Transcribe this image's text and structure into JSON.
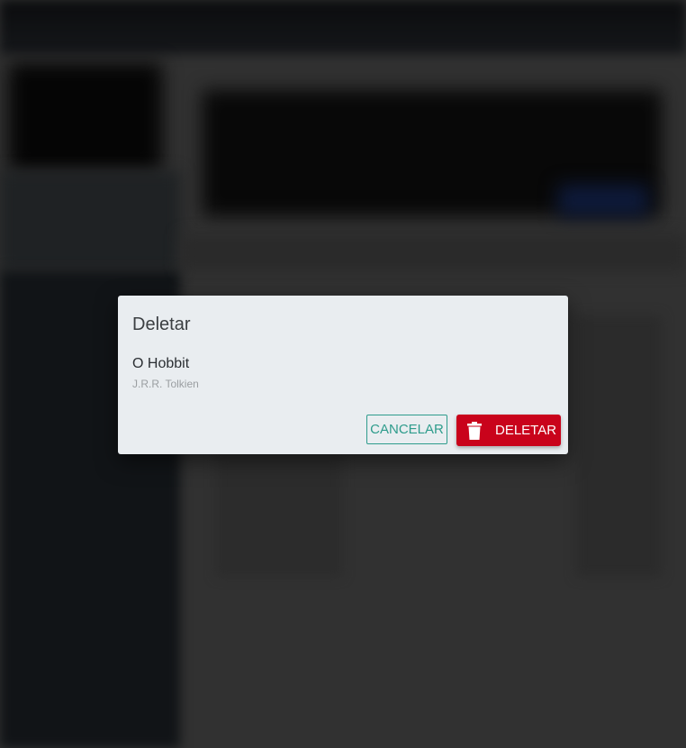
{
  "dialog": {
    "title": "Deletar",
    "book_title": "O Hobbit",
    "book_author": "J.R.R. Tolkien",
    "cancel_label": "CANCELAR",
    "delete_label": "DELETAR",
    "delete_icon": "trash-icon"
  },
  "colors": {
    "dialog_background": "#e9edf0",
    "cancel_accent": "#2e9c8c",
    "delete_background": "#c9031b",
    "overlay": "#313131"
  }
}
